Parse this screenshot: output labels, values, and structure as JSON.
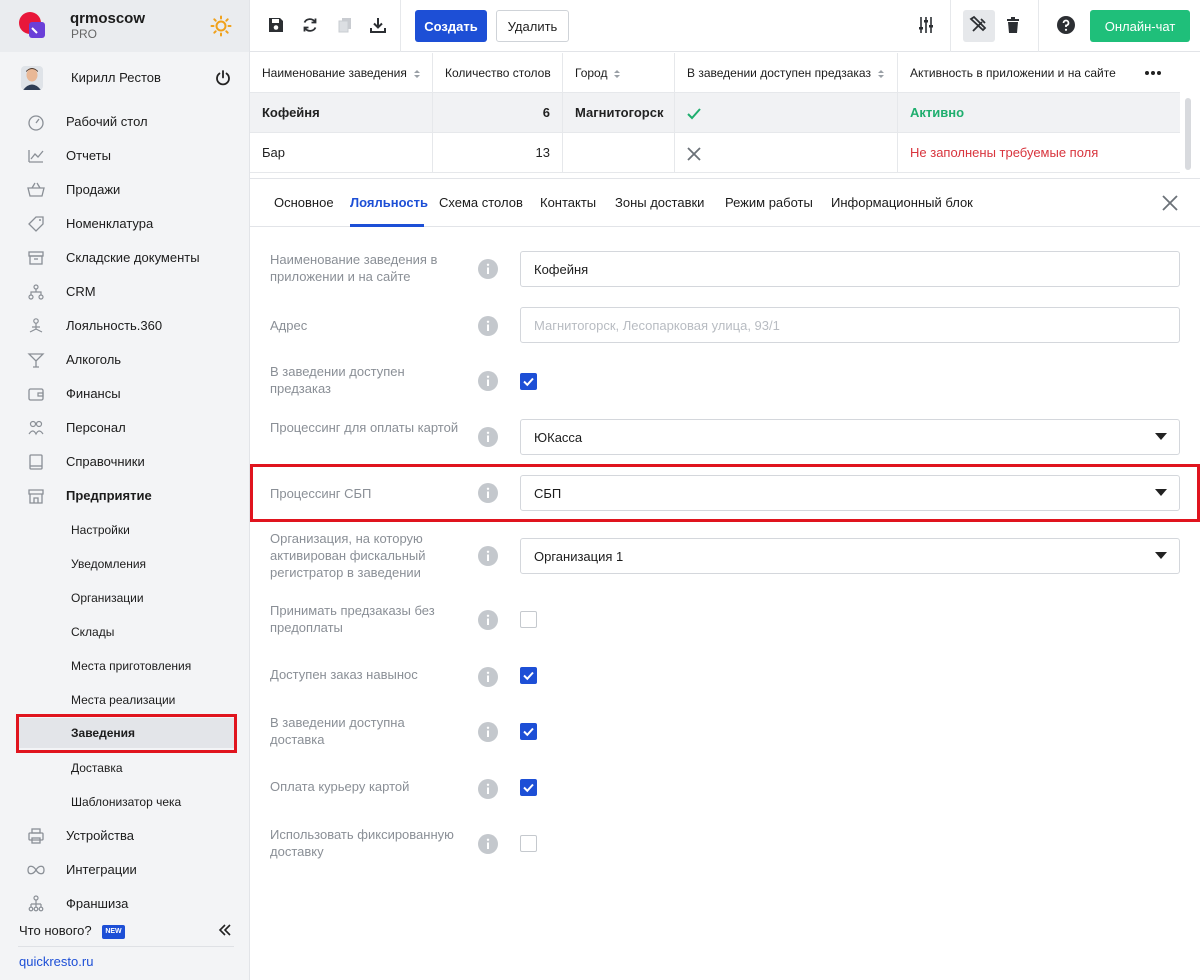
{
  "brand": {
    "name": "qrmoscow",
    "plan": "PRO"
  },
  "user": {
    "name": "Кирилл Рестов"
  },
  "nav": [
    {
      "label": "Рабочий стол",
      "icon": "dashboard-icon"
    },
    {
      "label": "Отчеты",
      "icon": "reports-icon"
    },
    {
      "label": "Продажи",
      "icon": "basket-icon"
    },
    {
      "label": "Номенклатура",
      "icon": "tag-icon"
    },
    {
      "label": "Складские документы",
      "icon": "warehouse-icon"
    },
    {
      "label": "CRM",
      "icon": "crm-icon"
    },
    {
      "label": "Лояльность.360",
      "icon": "loyalty-icon"
    },
    {
      "label": "Алкоголь",
      "icon": "cocktail-icon"
    },
    {
      "label": "Финансы",
      "icon": "wallet-icon"
    },
    {
      "label": "Персонал",
      "icon": "staff-icon"
    },
    {
      "label": "Справочники",
      "icon": "book-icon"
    },
    {
      "label": "Предприятие",
      "icon": "store-icon"
    }
  ],
  "subnav": [
    {
      "label": "Настройки"
    },
    {
      "label": "Уведомления"
    },
    {
      "label": "Организации"
    },
    {
      "label": "Склады"
    },
    {
      "label": "Места приготовления"
    },
    {
      "label": "Места реализации"
    },
    {
      "label": "Заведения"
    },
    {
      "label": "Доставка"
    },
    {
      "label": "Шаблонизатор чека"
    }
  ],
  "nav_bottom": [
    {
      "label": "Устройства",
      "icon": "printer-icon"
    },
    {
      "label": "Интеграции",
      "icon": "infinity-icon"
    },
    {
      "label": "Франшиза",
      "icon": "franchise-icon"
    }
  ],
  "footer": {
    "whats_new": "Что нового?",
    "badge": "NEW",
    "site": "quickresto.ru"
  },
  "toolbar": {
    "create_label": "Создать",
    "delete_label": "Удалить",
    "chat_label": "Онлайн-чат"
  },
  "table": {
    "columns": [
      "Наименование заведения",
      "Количество столов",
      "Город",
      "В заведении доступен предзаказ",
      "Активность в приложении и на сайте"
    ],
    "rows": [
      {
        "name": "Кофейня",
        "tables": "6",
        "city": "Магнитогорск",
        "preorder": true,
        "status": "Активно"
      },
      {
        "name": "Бар",
        "tables": "13",
        "city": "",
        "preorder": false,
        "status": "Не заполнены требуемые поля"
      }
    ]
  },
  "tabs": [
    "Основное",
    "Лояльность",
    "Схема столов",
    "Контакты",
    "Зоны доставки",
    "Режим работы",
    "Информационный блок"
  ],
  "active_tab": "Лояльность",
  "form": {
    "name_label": "Наименование заведения в приложении и на сайте",
    "name_value": "Кофейня",
    "address_label": "Адрес",
    "address_placeholder": "Магнитогорск, Лесопарковая улица, 93/1",
    "preorder_label": "В заведении доступен предзаказ",
    "preorder_checked": true,
    "card_processing_label": "Процессинг для оплаты картой",
    "card_processing_value": "ЮКасса",
    "sbp_label": "Процессинг СБП",
    "sbp_value": "СБП",
    "org_label": "Организация, на которую активирован фискальный регистратор в заведении",
    "org_value": "Организация 1",
    "no_prepay_label": "Принимать предзаказы без предоплаты",
    "no_prepay_checked": false,
    "takeaway_label": "Доступен заказ навынос",
    "takeaway_checked": true,
    "delivery_label": "В заведении доступна доставка",
    "delivery_checked": true,
    "courier_card_label": "Оплата курьеру картой",
    "courier_card_checked": true,
    "fixed_delivery_label": "Использовать фиксированную доставку",
    "fixed_delivery_checked": false
  },
  "colors": {
    "accent": "#1d4fd6",
    "success": "#1fae6e",
    "error": "#d8343d",
    "chat": "#1fbf7a",
    "highlight": "#e0141e"
  }
}
